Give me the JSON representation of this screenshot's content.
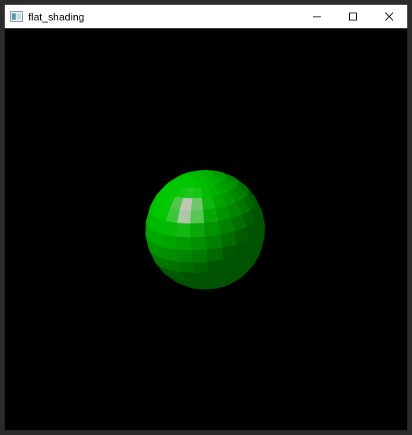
{
  "window": {
    "title": "flat_shading",
    "app_icon": "window-app-icon",
    "controls": {
      "minimize_icon": "minimize-icon",
      "maximize_icon": "maximize-icon",
      "close_icon": "close-icon"
    }
  },
  "viewport": {
    "background_color": "#000000",
    "object": "flat-shaded-sphere",
    "sphere_base_color": "#00a000",
    "sphere_highlight_color": "#b8ffb0"
  }
}
